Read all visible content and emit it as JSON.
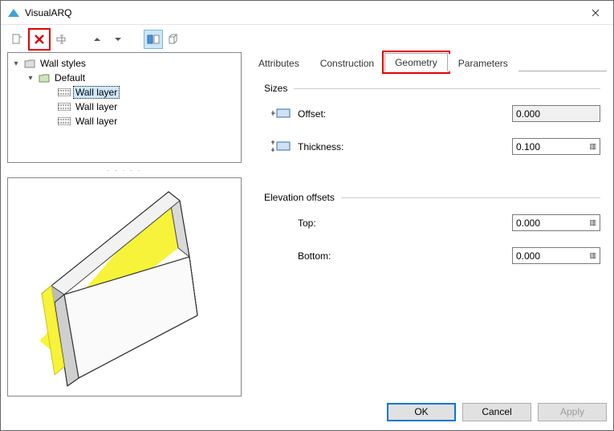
{
  "window": {
    "title": "VisualARQ"
  },
  "toolbar": {
    "items": [
      {
        "name": "new-icon"
      },
      {
        "name": "delete-icon"
      },
      {
        "name": "rename-icon"
      },
      {
        "name": "arrow-up-icon"
      },
      {
        "name": "arrow-down-icon"
      },
      {
        "name": "sep"
      },
      {
        "name": "view-toggle-a-icon",
        "active": true
      },
      {
        "name": "view-toggle-b-icon"
      }
    ]
  },
  "tree": {
    "root": {
      "label": "Wall styles",
      "children": [
        {
          "label": "Default",
          "children": [
            {
              "label": "Wall layer",
              "selected": true
            },
            {
              "label": "Wall layer"
            },
            {
              "label": "Wall layer"
            }
          ]
        }
      ]
    }
  },
  "tabs": [
    {
      "id": "attributes",
      "label": "Attributes"
    },
    {
      "id": "construction",
      "label": "Construction"
    },
    {
      "id": "geometry",
      "label": "Geometry",
      "active": true,
      "highlighted": true
    },
    {
      "id": "parameters",
      "label": "Parameters"
    }
  ],
  "geometry": {
    "sizes_title": "Sizes",
    "offset_label": "Offset:",
    "offset_value": "0.000",
    "thickness_label": "Thickness:",
    "thickness_value": "0.100",
    "elevation_title": "Elevation offsets",
    "top_label": "Top:",
    "top_value": "0.000",
    "bottom_label": "Bottom:",
    "bottom_value": "0.000"
  },
  "buttons": {
    "ok": "OK",
    "cancel": "Cancel",
    "apply": "Apply"
  }
}
